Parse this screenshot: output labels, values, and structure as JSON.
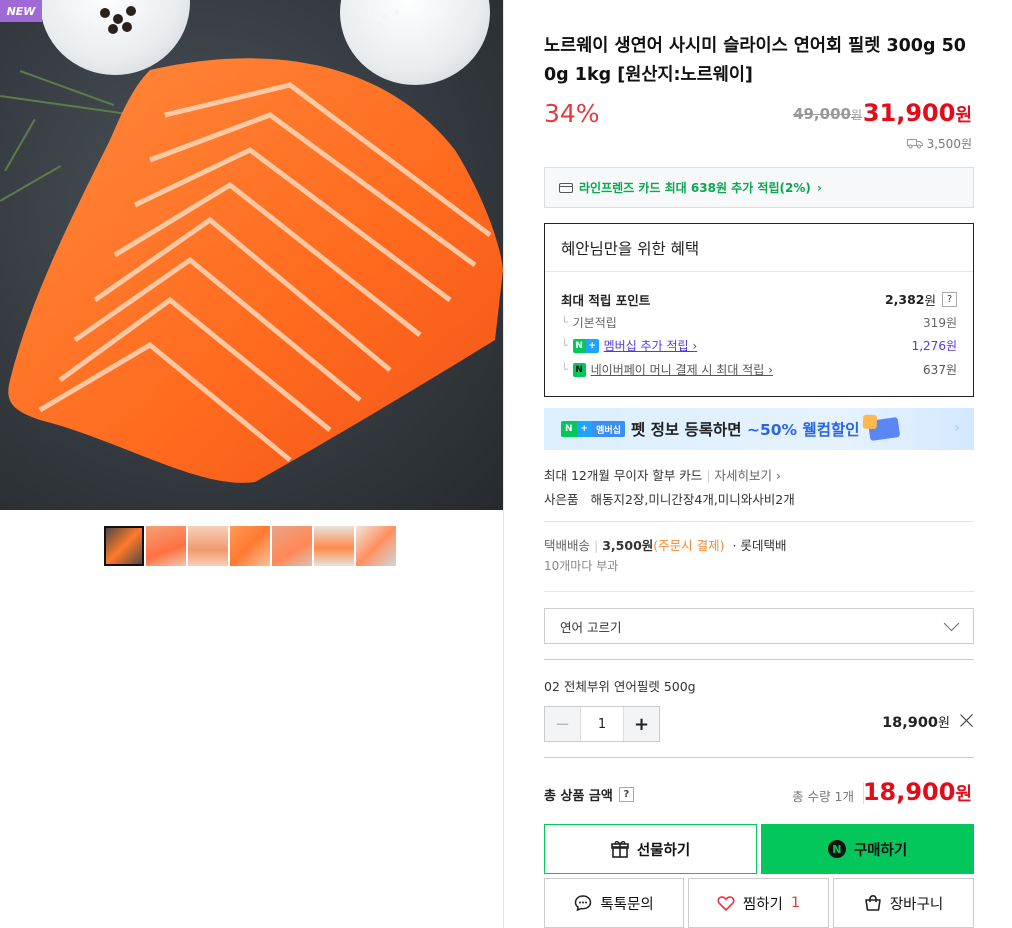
{
  "badge": {
    "new": "NEW"
  },
  "product": {
    "title": "노르웨이 생연어 사시미 슬라이스 연어회 필렛 300g 500g 1kg [원산지:노르웨이]",
    "discount": "34%",
    "original_price": "49,000",
    "original_price_unit": "원",
    "sale_price": "31,900",
    "sale_price_unit": "원",
    "shipping_fee": "3,500원"
  },
  "card_promo": {
    "text": "라인프렌즈 카드 최대 638원 추가 적립(2%)",
    "arrow": "›"
  },
  "benefits": {
    "title": "혜안님만을 위한 혜택",
    "max_points_label": "최대 적립 포인트",
    "max_points_value": "2,382",
    "max_points_unit": "원",
    "help": "?",
    "rows": [
      {
        "label": "기본적립",
        "value": "319원"
      },
      {
        "label": "멤버십 추가 적립 ›",
        "value": "1,276원"
      },
      {
        "label": "네이버페이 머니 결제 시 최대 적립 ›",
        "value": "637원"
      }
    ]
  },
  "banner": {
    "pill": "멤버십",
    "text_before": "펫 정보 등록하면 ",
    "text_highlight": "~50% 웰컴할인",
    "coupon": "50%",
    "arrow": "›"
  },
  "installment": {
    "text": "최대 12개월 무이자 할부 카드",
    "link": "자세히보기 ›"
  },
  "gift": {
    "label": "사은품",
    "value": "해동지2장,미니간장4개,미니와사비2개"
  },
  "delivery": {
    "label": "택배배송",
    "fee": "3,500원",
    "fee_note": "(주문시 결제)",
    "dot": "·",
    "carrier": "롯데택배",
    "note": "10개마다 부과"
  },
  "option_select": {
    "placeholder": "연어 고르기"
  },
  "selected_option": {
    "name": "02 전체부위 연어필렛 500g",
    "minus": "−",
    "qty": "1",
    "plus": "+",
    "price": "18,900",
    "price_unit": "원"
  },
  "total": {
    "label": "총 상품 금액",
    "help": "?",
    "qty_text": "총 수량 1개",
    "price": "18,900",
    "price_unit": "원"
  },
  "buttons": {
    "gift": "선물하기",
    "buy": "구매하기",
    "talk": "톡톡문의",
    "wish": "찜하기",
    "wish_count": "1",
    "cart": "장바구니"
  },
  "colors": {
    "naver_green": "#03c75a",
    "price_red": "#e30c1a",
    "discount_red": "#e9383d"
  }
}
